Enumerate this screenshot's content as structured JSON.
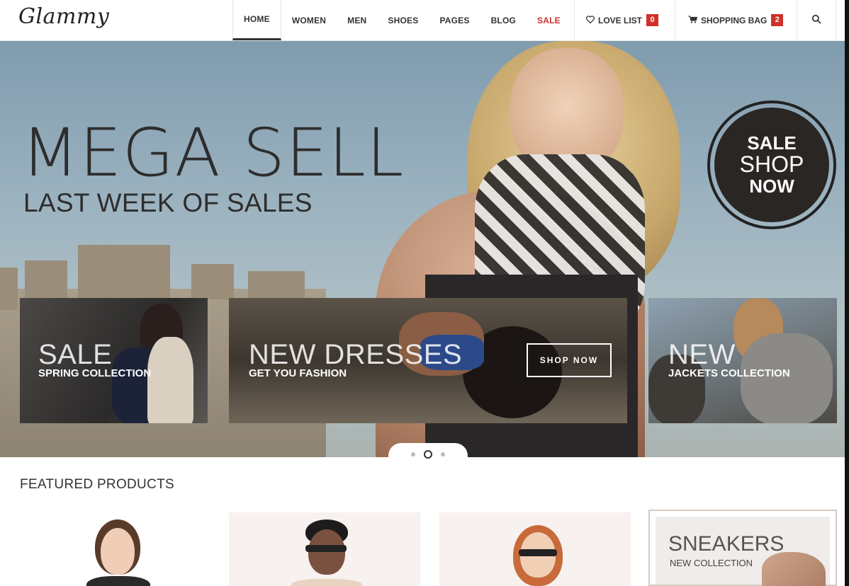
{
  "brand": {
    "logo": "Glammy"
  },
  "nav": {
    "items": [
      "HOME",
      "WOMEN",
      "MEN",
      "SHOES",
      "PAGES",
      "BLOG",
      "SALE"
    ],
    "active": "HOME",
    "love_list": {
      "label": "LOVE LIST",
      "count": "0"
    },
    "shopping_bag": {
      "label": "SHOPPING BAG",
      "count": "2"
    },
    "icons": {
      "love": "heart-icon",
      "bag": "cart-icon",
      "search": "search-icon"
    }
  },
  "hero": {
    "headline": "MEGA SELL",
    "subheadline": "LAST WEEK OF SALES",
    "badge": {
      "line1": "SALE",
      "line2": "SHOP",
      "line3": "NOW"
    },
    "slides": {
      "count": 3,
      "active_index": 2
    }
  },
  "promos": [
    {
      "title": "SALE",
      "subtitle": "SPRING COLLECTION"
    },
    {
      "title": "NEW DRESSES",
      "subtitle": "GET YOU FASHION",
      "button": "SHOP NOW"
    },
    {
      "title": "NEW",
      "subtitle": "JACKETS COLLECTION"
    }
  ],
  "featured": {
    "title": "FEATURED PRODUCTS",
    "sneakers": {
      "title": "SNEAKERS",
      "subtitle": "NEW COLLECTION"
    }
  },
  "colors": {
    "accent": "#d0302a",
    "dark": "#2a2624",
    "text": "#333333"
  }
}
